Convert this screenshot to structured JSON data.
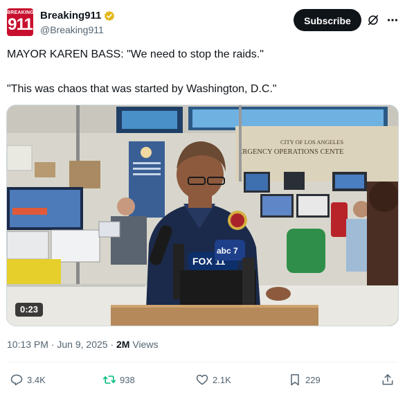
{
  "author": {
    "avatar_top": "BREAKING",
    "avatar_main": "911",
    "name": "Breaking911",
    "handle": "@Breaking911",
    "brand_color": "#c8102e"
  },
  "subscribe_label": "Subscribe",
  "icons": [
    "verified-badge-icon",
    "grok-icon",
    "more-icon",
    "reply-icon",
    "repost-icon",
    "like-icon",
    "bookmark-icon",
    "share-icon"
  ],
  "post": {
    "line1": "MAYOR KAREN BASS: \"We need to stop the raids.\"",
    "line2": "\"This was chaos that was started by Washington, D.C.\""
  },
  "media": {
    "duration": "0:23",
    "sign_line1": "CITY OF LOS ANGELES",
    "sign_line2": "ERGENCY OPERATIONS CENTE",
    "mic_logo1": "FOX 11",
    "mic_logo2": "abc 7"
  },
  "meta": {
    "time": "10:13 PM",
    "sep": "·",
    "date": "Jun 9, 2025",
    "views_count": "2M",
    "views_label": "Views"
  },
  "actions": {
    "replies": "3.4K",
    "reposts": "938",
    "likes": "2.1K",
    "bookmarks": "229"
  },
  "colors": {
    "text": "#0f1419",
    "secondary": "#536471",
    "repost_green": "#00ba7c",
    "verified_gold": "#e2b719"
  }
}
